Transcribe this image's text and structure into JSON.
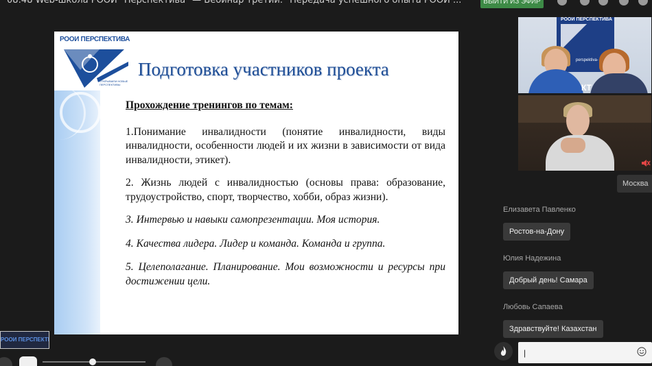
{
  "topbar": {
    "title": "08:48   Web-школа РООИ \"Перспектива\" — Вебинар третий. \"Передача успешного опыта РООИ ...",
    "button_label": "ВЫЙТИ ИЗ ЭФИР"
  },
  "slide": {
    "logo_text": "РООИ ПЕРСПЕКТИВА",
    "logo_sub": "ОТКРЫВАЕМ НОВЫЕ ПЕРСПЕКТИВЫ",
    "title": "Подготовка участников проекта",
    "subhead": "Прохождение  тренингов по темам:",
    "items": [
      "1.Понимание инвалидности (понятие инвалидности, виды инвалидности, особенности людей и их жизни в зависимости от вида инвалидности, этикет).",
      "2. Жизнь людей с инвалидностью (основы права: образование, трудоустройство, спорт, творчество, хобби, образ жизни).",
      "3. Интервью и навыки самопрезентации. Моя история.",
      "4. Качества лидера. Лидер и команда. Команда и группа.",
      "5. Целеполагание. Планирование. Мои возможности и ресурсы при достижении цели."
    ]
  },
  "mini_logo": "РООИ ПЕРСПЕКТИВА",
  "webcams": {
    "cam1_banner": "РООИ ПЕРСПЕКТИВА",
    "cam1_url": "perspektiva-",
    "cam1_mark": "КТ",
    "muted_icon": "microphone-muted-icon"
  },
  "location_tag": "Москва",
  "chat": {
    "messages": [
      {
        "author": "Елизавета Павленко",
        "text": "Ростов-на-Дону"
      },
      {
        "author": "Юлия Надежина",
        "text": "Добрый день! Самара"
      },
      {
        "author": "Любовь Сапаева",
        "text": "Здравствуйте! Казахстан"
      }
    ],
    "input_value": "|",
    "input_placeholder": ""
  },
  "colors": {
    "accent_blue": "#1f4e96",
    "live_button": "#3d8a46",
    "background": "#1b1b1b"
  }
}
